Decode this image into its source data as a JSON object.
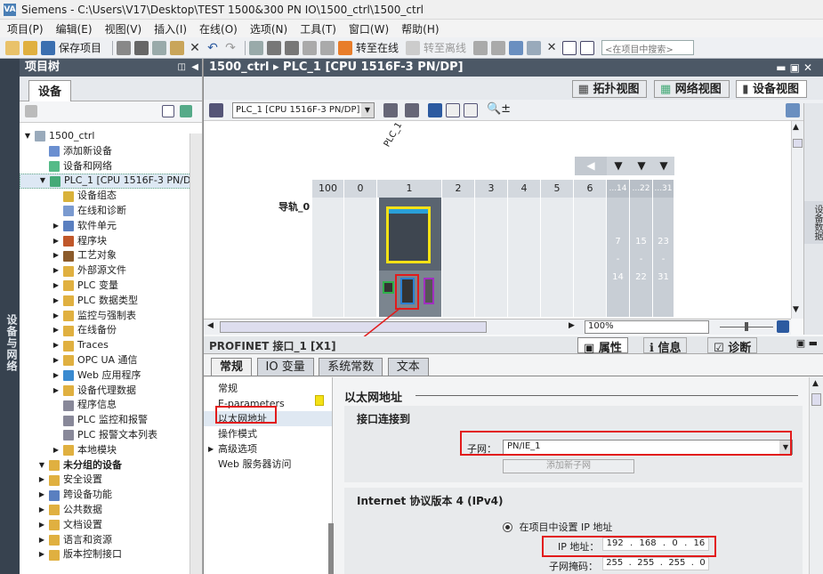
{
  "window": {
    "title": "Siemens  -  C:\\Users\\V17\\Desktop\\TEST 1500&300 PN IO\\1500_ctrl\\1500_ctrl",
    "logo": "VA"
  },
  "menu": [
    "项目(P)",
    "编辑(E)",
    "视图(V)",
    "插入(I)",
    "在线(O)",
    "选项(N)",
    "工具(T)",
    "窗口(W)",
    "帮助(H)"
  ],
  "toolbar": {
    "save_label": "保存项目",
    "go_online": "转至在线",
    "go_offline": "转至离线",
    "search_placeholder": "<在项目中搜索>"
  },
  "left_vtab": "设备与网络",
  "project_tree": {
    "title": "项目树",
    "devices_tab": "设备",
    "items": [
      {
        "label": "1500_ctrl",
        "indent": 0,
        "tri": "▼",
        "icon": "#9ab"
      },
      {
        "label": "添加新设备",
        "indent": 1,
        "tri": "",
        "icon": "#6a8fd0"
      },
      {
        "label": "设备和网络",
        "indent": 1,
        "tri": "",
        "icon": "#5b8"
      },
      {
        "label": "PLC_1 [CPU 1516F-3 PN/DP]",
        "indent": 1,
        "tri": "▼",
        "icon": "#4a7"
      },
      {
        "label": "设备组态",
        "indent": 2,
        "tri": "",
        "icon": "#d9b23a"
      },
      {
        "label": "在线和诊断",
        "indent": 2,
        "tri": "",
        "icon": "#7a9ad0"
      },
      {
        "label": "软件单元",
        "indent": 2,
        "tri": "▶",
        "icon": "#5a7fc0"
      },
      {
        "label": "程序块",
        "indent": 2,
        "tri": "▶",
        "icon": "#c0572a"
      },
      {
        "label": "工艺对象",
        "indent": 2,
        "tri": "▶",
        "icon": "#8b5a2a"
      },
      {
        "label": "外部源文件",
        "indent": 2,
        "tri": "▶",
        "icon": "#e0b040"
      },
      {
        "label": "PLC 变量",
        "indent": 2,
        "tri": "▶",
        "icon": "#e0b040"
      },
      {
        "label": "PLC 数据类型",
        "indent": 2,
        "tri": "▶",
        "icon": "#e0b040"
      },
      {
        "label": "监控与强制表",
        "indent": 2,
        "tri": "▶",
        "icon": "#e0b040"
      },
      {
        "label": "在线备份",
        "indent": 2,
        "tri": "▶",
        "icon": "#e0b040"
      },
      {
        "label": "Traces",
        "indent": 2,
        "tri": "▶",
        "icon": "#e0b040"
      },
      {
        "label": "OPC UA 通信",
        "indent": 2,
        "tri": "▶",
        "icon": "#e0b040"
      },
      {
        "label": "Web 应用程序",
        "indent": 2,
        "tri": "▶",
        "icon": "#3a8ad0"
      },
      {
        "label": "设备代理数据",
        "indent": 2,
        "tri": "▶",
        "icon": "#e0b040"
      },
      {
        "label": "程序信息",
        "indent": 2,
        "tri": "",
        "icon": "#889"
      },
      {
        "label": "PLC 监控和报警",
        "indent": 2,
        "tri": "",
        "icon": "#889"
      },
      {
        "label": "PLC 报警文本列表",
        "indent": 2,
        "tri": "",
        "icon": "#889"
      },
      {
        "label": "本地模块",
        "indent": 2,
        "tri": "▶",
        "icon": "#e0b040"
      },
      {
        "label": "未分组的设备",
        "indent": 1,
        "tri": "▼",
        "icon": "#e0b040",
        "bold": true
      },
      {
        "label": "安全设置",
        "indent": 1,
        "tri": "▶",
        "icon": "#e0b040"
      },
      {
        "label": "跨设备功能",
        "indent": 1,
        "tri": "▶",
        "icon": "#5a7fc0"
      },
      {
        "label": "公共数据",
        "indent": 1,
        "tri": "▶",
        "icon": "#e0b040"
      },
      {
        "label": "文档设置",
        "indent": 1,
        "tri": "▶",
        "icon": "#e0b040"
      },
      {
        "label": "语言和资源",
        "indent": 1,
        "tri": "▶",
        "icon": "#e0b040"
      },
      {
        "label": "版本控制接口",
        "indent": 1,
        "tri": "▶",
        "icon": "#e0b040"
      }
    ]
  },
  "editor": {
    "breadcrumb": "1500_ctrl ▸ PLC_1 [CPU 1516F-3 PN/DP]",
    "views": {
      "topology": "拓扑视图",
      "network": "网络视图",
      "device": "设备视图"
    },
    "device_select": "PLC_1 [CPU 1516F-3 PN/DP]",
    "device_label": "PLC_1",
    "rail_label": "导轨_0",
    "slots": [
      "100",
      "0",
      "1",
      "2",
      "3",
      "4",
      "5",
      "6",
      "...14",
      "...22",
      "...31"
    ],
    "slot_nums_a": [
      "7",
      "-",
      "14"
    ],
    "slot_nums_b": [
      "15",
      "-",
      "22"
    ],
    "slot_nums_c": [
      "23",
      "-",
      "31"
    ],
    "zoom": "100%",
    "right_vtab": "设备数据"
  },
  "inspector": {
    "title": "PROFINET 接口_1 [X1]",
    "props": "属性",
    "info": "信息",
    "diag": "诊断",
    "tabs": [
      "常规",
      "IO 变量",
      "系统常数",
      "文本"
    ],
    "nav": [
      "常规",
      "E-parameters",
      "以太网地址",
      "操作模式",
      "高级选项",
      "Web 服务器访问"
    ],
    "section_title": "以太网地址",
    "sub_conn": "接口连接到",
    "subnet_label": "子网：",
    "subnet_value": "PN/IE_1",
    "add_subnet": "添加新子网",
    "ipv4_title": "Internet 协议版本 4 (IPv4)",
    "ip_option": "在项目中设置 IP 地址",
    "ip_label": "IP 地址：",
    "ip": [
      "192",
      "168",
      "0",
      "16"
    ],
    "mask_label": "子网掩码：",
    "mask": [
      "255",
      "255",
      "255",
      "0"
    ]
  }
}
